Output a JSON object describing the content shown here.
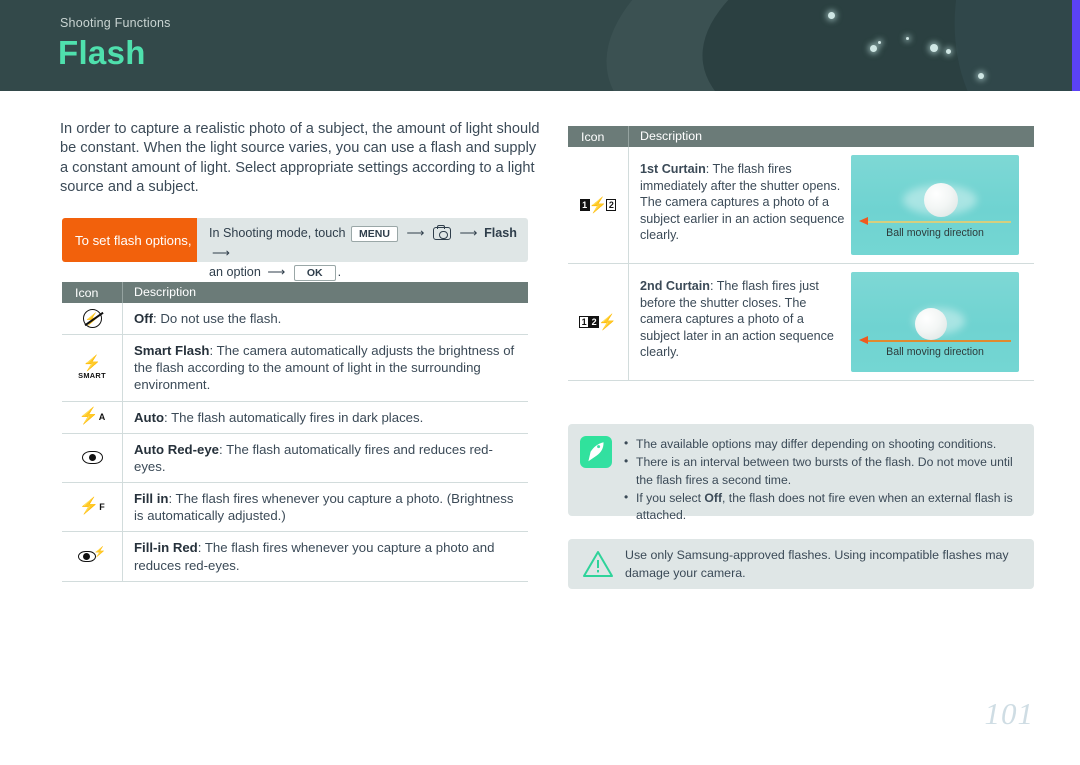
{
  "header": {
    "kicker": "Shooting Functions",
    "title": "Flash",
    "bg_color": "#33494a",
    "title_color": "#4fe0ad",
    "accent_strip_color": "#5b42f5"
  },
  "intro": "In order to capture a realistic photo of a subject, the amount of light should be constant. When the light source varies, you can use a flash and supply a constant amount of light. Select appropriate settings according to a light source and a subject.",
  "callout": {
    "tag": "To set flash options,",
    "tag_color": "#f2610c",
    "prefix": "In Shooting mode, touch",
    "key_menu": "MENU",
    "icon_camera": "camera-icon",
    "label_flash": "Flash",
    "mid": "an option",
    "key_ok": "OK",
    "period": "."
  },
  "left_table": {
    "headers": {
      "icon": "Icon",
      "description": "Description"
    },
    "rows": [
      {
        "icon": "flash-off-icon",
        "term": "Off",
        "text": ": Do not use the flash."
      },
      {
        "icon": "smart-flash-icon",
        "icon_label": "SMART",
        "term": "Smart Flash",
        "text": ": The camera automatically adjusts the brightness of the flash according to the amount of light in the surrounding environment."
      },
      {
        "icon": "flash-auto-icon",
        "icon_sup": "A",
        "term": "Auto",
        "text": ": The flash automatically fires in dark places."
      },
      {
        "icon": "auto-red-eye-icon",
        "term": "Auto Red-eye",
        "text": ": The flash automatically fires and reduces red-eyes."
      },
      {
        "icon": "fill-in-icon",
        "icon_sup": "F",
        "term": "Fill in",
        "text": ": The flash fires whenever you capture a photo. (Brightness is automatically adjusted.)"
      },
      {
        "icon": "fill-in-red-icon",
        "term": "Fill-in Red",
        "text": ": The flash fires whenever you capture a photo and reduces red-eyes."
      }
    ]
  },
  "right_table": {
    "headers": {
      "icon": "Icon",
      "description": "Description"
    },
    "rows": [
      {
        "icon": "first-curtain-icon",
        "icon_nums": [
          "1",
          "2"
        ],
        "term": "1st Curtain",
        "text": ": The flash fires immediately after the shutter opens. The camera captures a photo of a subject earlier in an action sequence clearly.",
        "image_caption": "Ball moving direction",
        "image_bg": "#74d6d3"
      },
      {
        "icon": "second-curtain-icon",
        "icon_nums": [
          "1",
          "2"
        ],
        "term": "2nd Curtain",
        "text": ": The flash fires just before the shutter closes. The camera captures a photo of a subject later in an action sequence clearly.",
        "image_caption": "Ball moving direction",
        "image_bg": "#74d6d3"
      }
    ]
  },
  "note_box": {
    "icon": "note-pen-icon",
    "icon_color": "#2fe39a",
    "items": [
      {
        "pre": "The available options may differ depending on shooting conditions.",
        "bold": "",
        "post": ""
      },
      {
        "pre": "There is an interval between two bursts of the flash. Do not move until the flash fires a second time.",
        "bold": "",
        "post": ""
      },
      {
        "pre": "If you select ",
        "bold": "Off",
        "post": ", the flash does not fire even when an external flash is attached."
      }
    ]
  },
  "warning_box": {
    "icon": "warning-triangle-icon",
    "icon_color": "#2fd39a",
    "text": "Use only Samsung-approved flashes. Using incompatible flashes may damage your camera."
  },
  "page_number": "101"
}
